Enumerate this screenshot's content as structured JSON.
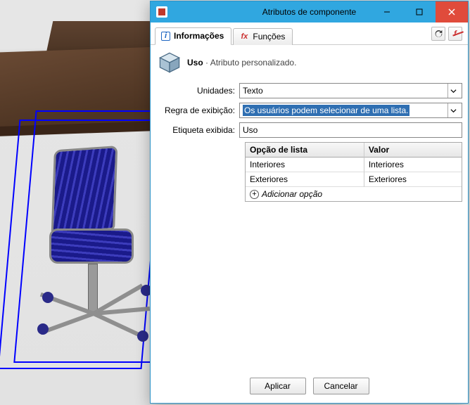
{
  "window": {
    "title": "Atributos de componente",
    "minimize": "–",
    "maximize": "□",
    "close": "✕"
  },
  "tabs": {
    "info": "Informações",
    "functions": "Funções"
  },
  "toolbar": {
    "refresh_icon": "refresh",
    "toggle_icon": "fx-toggle"
  },
  "header": {
    "title": "Uso",
    "subtitle": "Atributo personalizado."
  },
  "form": {
    "units_label": "Unidades:",
    "units_value": "Texto",
    "display_rule_label": "Regra de exibição:",
    "display_rule_value": "Os usuários podem selecionar de uma lista.",
    "shown_label_label": "Etiqueta exibida:",
    "shown_label_value": "Uso"
  },
  "list": {
    "col_option": "Opção de lista",
    "col_value": "Valor",
    "rows": [
      {
        "option": "Interiores",
        "value": "Interiores"
      },
      {
        "option": "Exteriores",
        "value": "Exteriores"
      }
    ],
    "add_label": "Adicionar opção"
  },
  "footer": {
    "apply": "Aplicar",
    "cancel": "Cancelar"
  }
}
